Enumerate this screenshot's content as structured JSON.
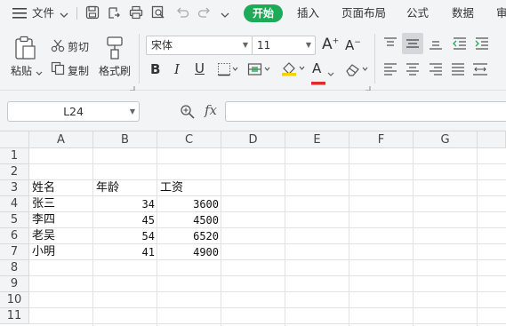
{
  "menubar": {
    "file_label": "文件",
    "tabs": [
      "开始",
      "插入",
      "页面布局",
      "公式",
      "数据",
      "审"
    ]
  },
  "ribbon": {
    "paste_label": "粘贴",
    "cut_label": "剪切",
    "copy_label": "复制",
    "format_painter_label": "格式刷",
    "font_name": "宋体",
    "font_size": "11",
    "bold_label": "B",
    "italic_label": "I",
    "underline_label": "U",
    "font_color_label": "A",
    "grow_font_label": "A",
    "shrink_font_label": "A",
    "accent_font_color": "#e32a2a",
    "accent_fill_color": "#f5d300"
  },
  "formula_bar": {
    "cell_ref": "L24",
    "fx_label": "fx",
    "formula": ""
  },
  "sheet": {
    "columns": [
      "A",
      "B",
      "C",
      "D",
      "E",
      "F",
      "G"
    ],
    "rows": [
      "1",
      "2",
      "3",
      "4",
      "5",
      "6",
      "7",
      "8",
      "9",
      "10",
      "11"
    ],
    "headers": [
      "姓名",
      "年龄",
      "工资"
    ],
    "data": [
      [
        "张三",
        "34",
        "3600"
      ],
      [
        "李四",
        "45",
        "4500"
      ],
      [
        "老吴",
        "54",
        "6520"
      ],
      [
        "小明",
        "41",
        "4900"
      ]
    ]
  }
}
